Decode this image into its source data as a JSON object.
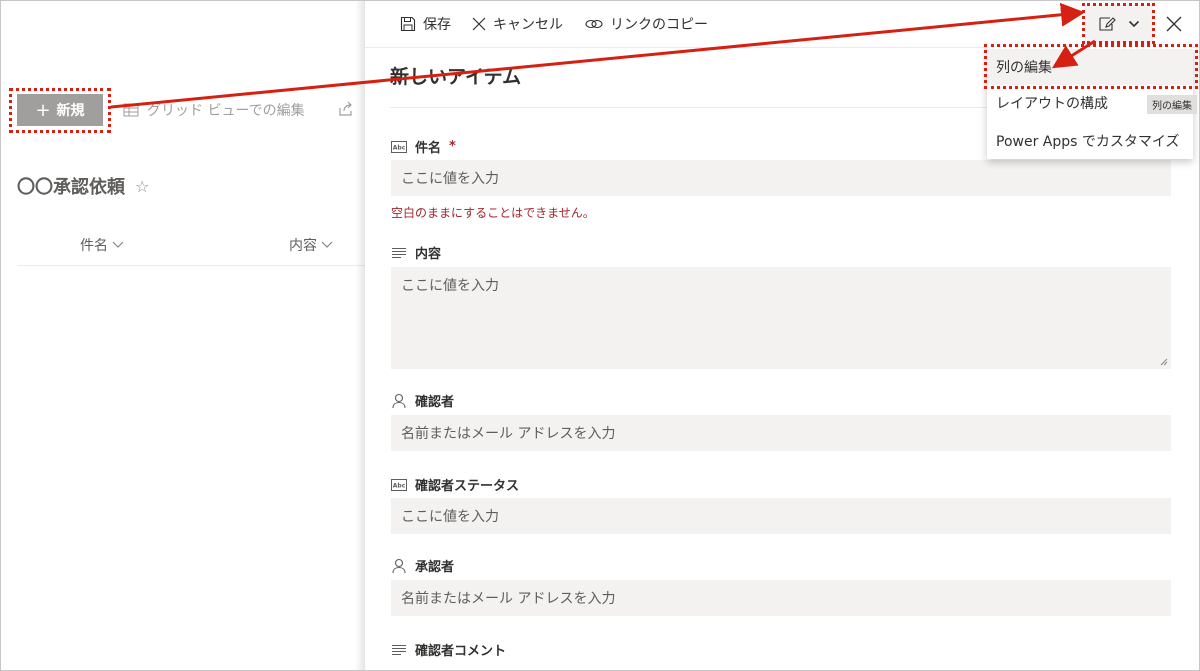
{
  "list": {
    "new_label": "新規",
    "grid_label": "グリッド ビューでの編集",
    "title": "〇〇承認依頼",
    "star": "☆",
    "col_subject": "件名",
    "col_content": "内容"
  },
  "panel": {
    "save_label": "保存",
    "cancel_label": "キャンセル",
    "copy_link_label": "リンクのコピー",
    "title": "新しいアイテム",
    "fields": {
      "subject": {
        "label": "件名",
        "required": "*",
        "placeholder": "ここに値を入力",
        "error": "空白のままにすることはできません。"
      },
      "content": {
        "label": "内容",
        "placeholder": "ここに値を入力"
      },
      "confirmer": {
        "label": "確認者",
        "placeholder": "名前またはメール アドレスを入力"
      },
      "confirmer_status": {
        "label": "確認者ステータス",
        "placeholder": "ここに値を入力"
      },
      "approver": {
        "label": "承認者",
        "placeholder": "名前またはメール アドレスを入力"
      },
      "confirmer_comment": {
        "label": "確認者コメント"
      }
    }
  },
  "menu": {
    "items": [
      "列の編集",
      "レイアウトの構成",
      "Power Apps でカスタマイズ"
    ],
    "tooltip": "列の編集"
  },
  "colors": {
    "annotation": "#d62011",
    "error": "#a4262c",
    "input_bg": "#f3f2f1"
  },
  "icons": [
    "plus-icon",
    "grid-icon",
    "share-icon",
    "save-icon",
    "cancel-icon",
    "link-icon",
    "edit-form-icon",
    "chevron-down-icon",
    "close-icon",
    "text-field-icon",
    "multiline-icon",
    "person-icon"
  ]
}
